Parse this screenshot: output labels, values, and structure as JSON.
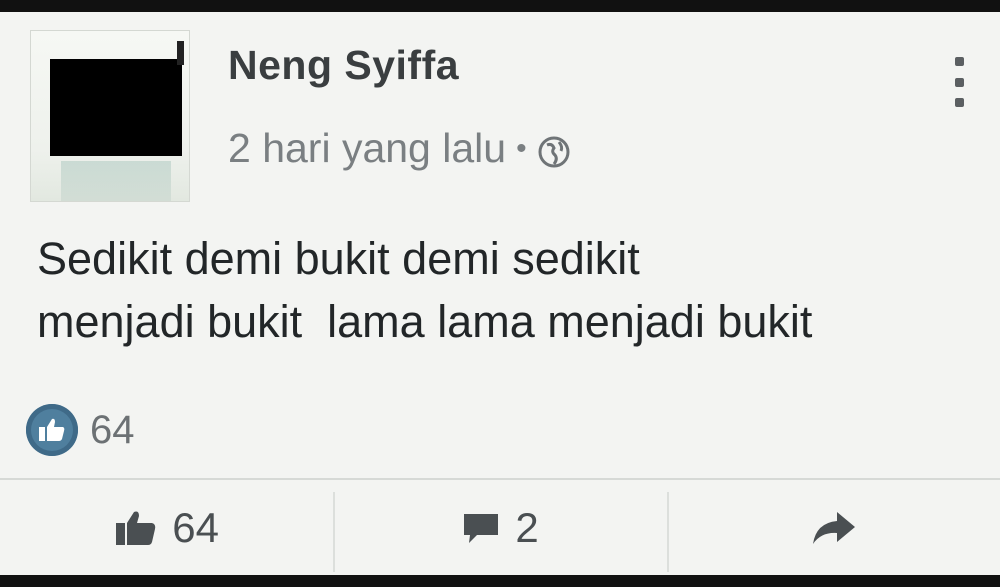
{
  "post": {
    "author_name": "Neng Syiffa",
    "timestamp": "2 hari yang lalu",
    "separator": "•",
    "privacy_icon": "globe-icon",
    "text": "Sedikit demi bukit demi sedikit\nmenjadi bukit  lama lama menjadi bukit",
    "reaction_count": "64"
  },
  "actions": {
    "like_count": "64",
    "comment_count": "2",
    "share_icon": "share-arrow-icon"
  },
  "colors": {
    "background": "#f3f4f2",
    "reaction_badge": "#4f7f9e",
    "text": "#222628",
    "muted": "#7a7f82"
  }
}
